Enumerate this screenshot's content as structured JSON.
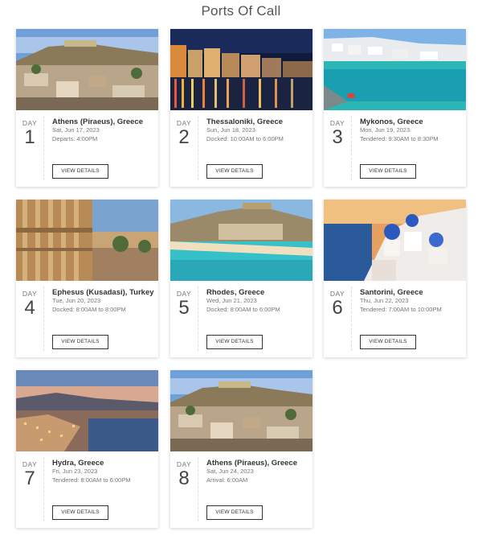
{
  "page": {
    "title": "Ports Of Call"
  },
  "ports": [
    {
      "day_label": "DAY",
      "day": "1",
      "name": "Athens (Piraeus), Greece",
      "date": "Sat, Jun 17, 2023",
      "time": "Departs: 4:00PM",
      "button": "VIEW DETAILS"
    },
    {
      "day_label": "DAY",
      "day": "2",
      "name": "Thessaloniki, Greece",
      "date": "Sun, Jun 18, 2023",
      "time": "Docked: 10:00AM to 6:00PM",
      "button": "VIEW DETAILS"
    },
    {
      "day_label": "DAY",
      "day": "3",
      "name": "Mykonos, Greece",
      "date": "Mon, Jun 19, 2023",
      "time": "Tendered: 9:30AM to 8:30PM",
      "button": "VIEW DETAILS"
    },
    {
      "day_label": "DAY",
      "day": "4",
      "name": "Ephesus (Kusadasi), Turkey",
      "date": "Tue, Jun 20, 2023",
      "time": "Docked: 8:00AM to 8:00PM",
      "button": "VIEW DETAILS"
    },
    {
      "day_label": "DAY",
      "day": "5",
      "name": "Rhodes, Greece",
      "date": "Wed, Jun 21, 2023",
      "time": "Docked: 8:00AM to 6:00PM",
      "button": "VIEW DETAILS"
    },
    {
      "day_label": "DAY",
      "day": "6",
      "name": "Santorini, Greece",
      "date": "Thu, Jun 22, 2023",
      "time": "Tendered: 7:00AM to 10:00PM",
      "button": "VIEW DETAILS"
    },
    {
      "day_label": "DAY",
      "day": "7",
      "name": "Hydra, Greece",
      "date": "Fri, Jun 23, 2023",
      "time": "Tendered: 8:00AM to 6:00PM",
      "button": "VIEW DETAILS"
    },
    {
      "day_label": "DAY",
      "day": "8",
      "name": "Athens (Piraeus), Greece",
      "date": "Sat, Jun 24, 2023",
      "time": "Arrival: 6:00AM",
      "button": "VIEW DETAILS"
    }
  ]
}
